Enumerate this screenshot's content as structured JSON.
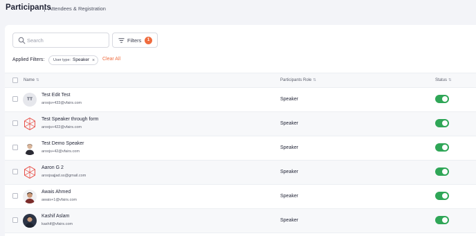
{
  "header": {
    "title": "Participants",
    "subtitle": "Attendees & Registration"
  },
  "toolbar": {
    "search_placeholder": "Search",
    "filters_label": "Filters",
    "filters_count": "1"
  },
  "applied_filters": {
    "label": "Applied Filters:",
    "chip_key": "User type:",
    "chip_value": "Speaker",
    "chip_remove": "×",
    "clear_all": "Clear All"
  },
  "table": {
    "columns": [
      "Name",
      "Participants Role",
      "Status"
    ],
    "sort_glyph": "⇅",
    "rows": [
      {
        "name": "Test Edit Test",
        "email": "aroojs+433@vfairs.com",
        "role": "Speaker",
        "avatar": "initials",
        "initials": "TT",
        "status_on": true
      },
      {
        "name": "Test Speaker through form",
        "email": "aroojs+422@vfairs.com",
        "role": "Speaker",
        "avatar": "logo-icon",
        "status_on": true
      },
      {
        "name": "Test Demo Speaker",
        "email": "aroojs+42@vfairs.com",
        "role": "Speaker",
        "avatar": "photo",
        "status_on": true
      },
      {
        "name": "Aaron G 2",
        "email": "aroojsajjad.ss@gmail.com",
        "role": "Speaker",
        "avatar": "logo-icon",
        "status_on": true
      },
      {
        "name": "Awais Ahmed",
        "email": "awais+1@vfairs.com",
        "role": "Speaker",
        "avatar": "photo",
        "status_on": true
      },
      {
        "name": "Kashif Aslam",
        "email": "kashif@vfairs.com",
        "role": "Speaker",
        "avatar": "photo",
        "status_on": true
      }
    ]
  },
  "colors": {
    "accent": "#ef6c3f",
    "toggle_on": "#2fa657",
    "logo": "#e8524a"
  }
}
